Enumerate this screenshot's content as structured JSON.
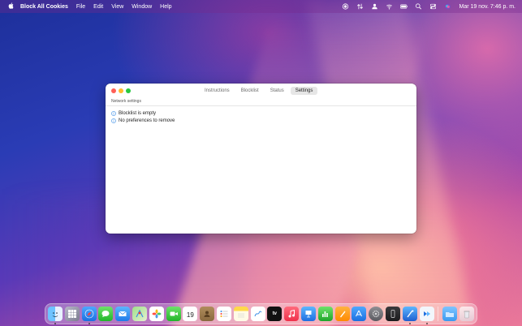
{
  "menubar": {
    "app_name": "Block All Cookies",
    "menus": [
      "File",
      "Edit",
      "View",
      "Window",
      "Help"
    ],
    "clock": "Mar 19 nov. 7:46 p. m."
  },
  "window": {
    "tabs": [
      {
        "label": "Instructions",
        "active": false
      },
      {
        "label": "Blocklist",
        "active": false
      },
      {
        "label": "Status",
        "active": false
      },
      {
        "label": "Settings",
        "active": true
      }
    ],
    "section_title": "Network settings",
    "messages": [
      "Blocklist is empty",
      "No preferences to remove"
    ]
  },
  "dock": {
    "calendar_day": "19",
    "tv_label": "tv",
    "apps": [
      "finder",
      "launchpad",
      "safari",
      "messages",
      "mail",
      "maps",
      "photos",
      "facetime",
      "calendar",
      "contacts",
      "reminders",
      "notes",
      "freeform",
      "tv",
      "music",
      "keynote",
      "numbers",
      "pages",
      "app-store",
      "system-settings",
      "iphone-mirroring",
      "xcode",
      "block-all-cookies",
      "downloads",
      "trash"
    ]
  },
  "colors": {
    "accent": "#3a8ee6",
    "close": "#ff5f57",
    "minimize": "#febc2e",
    "maximize": "#28c840"
  }
}
